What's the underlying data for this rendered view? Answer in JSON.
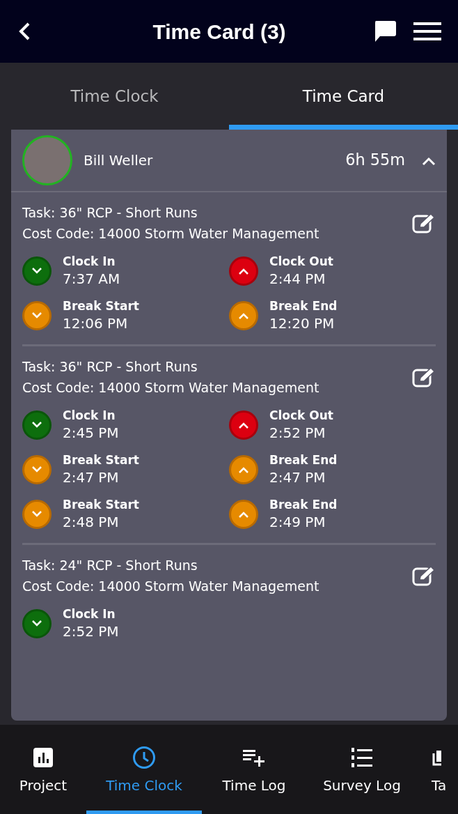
{
  "header": {
    "title": "Time Card (3)"
  },
  "tabs": [
    {
      "label": "Time Clock",
      "selected": false
    },
    {
      "label": "Time Card",
      "selected": true
    }
  ],
  "employee": {
    "name": "Bill Weller",
    "total": "6h 55m"
  },
  "entries": [
    {
      "task": "Task: 36\" RCP - Short Runs",
      "cost_code": "Cost Code: 14000 Storm Water Management",
      "events": [
        {
          "kind": "clock_in",
          "label": "Clock In",
          "time": "7:37 AM"
        },
        {
          "kind": "clock_out",
          "label": "Clock Out",
          "time": "2:44 PM"
        },
        {
          "kind": "break_start",
          "label": "Break Start",
          "time": "12:06 PM"
        },
        {
          "kind": "break_end",
          "label": "Break End",
          "time": "12:20 PM"
        }
      ]
    },
    {
      "task": "Task: 36\" RCP - Short Runs",
      "cost_code": "Cost Code: 14000 Storm Water Management",
      "events": [
        {
          "kind": "clock_in",
          "label": "Clock In",
          "time": "2:45 PM"
        },
        {
          "kind": "clock_out",
          "label": "Clock Out",
          "time": "2:52 PM"
        },
        {
          "kind": "break_start",
          "label": "Break Start",
          "time": "2:47 PM"
        },
        {
          "kind": "break_end",
          "label": "Break End",
          "time": "2:47 PM"
        },
        {
          "kind": "break_start",
          "label": "Break Start",
          "time": "2:48 PM"
        },
        {
          "kind": "break_end",
          "label": "Break End",
          "time": "2:49 PM"
        }
      ]
    },
    {
      "task": "Task: 24\" RCP - Short Runs",
      "cost_code": "Cost Code: 14000 Storm Water Management",
      "events": [
        {
          "kind": "clock_in",
          "label": "Clock In",
          "time": "2:52 PM"
        }
      ]
    }
  ],
  "bottom_nav": [
    {
      "kind": "chart",
      "label": "Project",
      "selected": false
    },
    {
      "kind": "clock",
      "label": "Time Clock",
      "selected": true
    },
    {
      "kind": "list_add",
      "label": "Time Log",
      "selected": false
    },
    {
      "kind": "numbered_list",
      "label": "Survey Log",
      "selected": false
    },
    {
      "kind": "copy",
      "label": "Ta",
      "selected": false
    }
  ]
}
